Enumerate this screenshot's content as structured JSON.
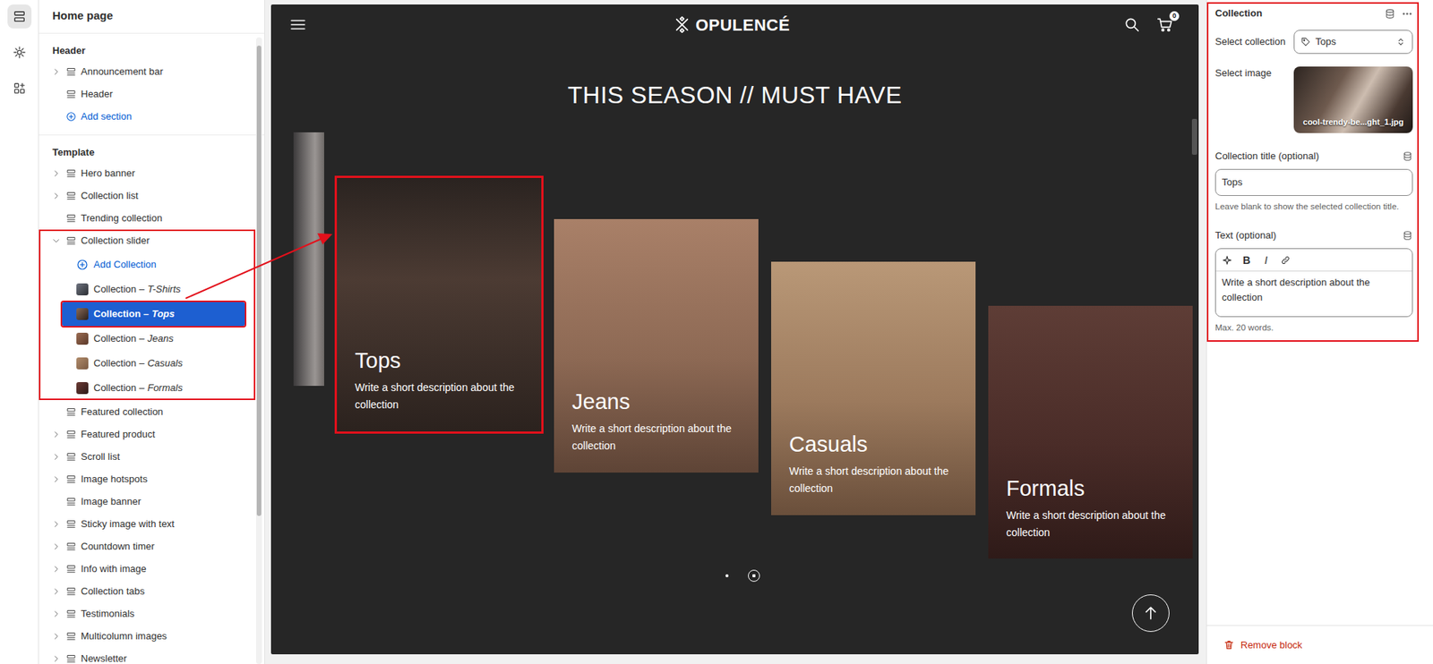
{
  "rail": [
    {
      "selected": true
    },
    {
      "selected": false
    },
    {
      "selected": false
    }
  ],
  "sidebar": {
    "title": "Home page",
    "groups": [
      {
        "label": "Header",
        "items": [
          {
            "kind": "section",
            "label": "Announcement bar",
            "expandable": true,
            "expanded": false,
            "annotated": false
          },
          {
            "kind": "section",
            "label": "Header",
            "expandable": false,
            "expanded": false,
            "annotated": false
          },
          {
            "kind": "add",
            "label": "Add section"
          }
        ]
      },
      {
        "label": "Template",
        "items": [
          {
            "kind": "section",
            "label": "Hero banner",
            "expandable": true,
            "expanded": false,
            "annotated": false
          },
          {
            "kind": "section",
            "label": "Collection list",
            "expandable": true,
            "expanded": false,
            "annotated": false
          },
          {
            "kind": "section",
            "label": "Trending collection",
            "expandable": false,
            "expanded": false,
            "annotated": false
          },
          {
            "kind": "section",
            "label": "Collection slider",
            "expandable": true,
            "expanded": true,
            "annotated": true,
            "children": [
              {
                "kind": "add",
                "label": "Add Collection"
              },
              {
                "kind": "block",
                "label": "Collection –",
                "detail": "T-Shirts",
                "selected": false,
                "annotated": false
              },
              {
                "kind": "block",
                "label": "Collection –",
                "detail": "Tops",
                "selected": true,
                "annotated": true
              },
              {
                "kind": "block",
                "label": "Collection –",
                "detail": "Jeans",
                "selected": false,
                "annotated": false
              },
              {
                "kind": "block",
                "label": "Collection –",
                "detail": "Casuals",
                "selected": false,
                "annotated": false
              },
              {
                "kind": "block",
                "label": "Collection –",
                "detail": "Formals",
                "selected": false,
                "annotated": false
              }
            ]
          },
          {
            "kind": "section",
            "label": "Featured collection",
            "expandable": false,
            "expanded": false,
            "annotated": false
          },
          {
            "kind": "section",
            "label": "Featured product",
            "expandable": true,
            "expanded": false,
            "annotated": false
          },
          {
            "kind": "section",
            "label": "Scroll list",
            "expandable": true,
            "expanded": false,
            "annotated": false
          },
          {
            "kind": "section",
            "label": "Image hotspots",
            "expandable": true,
            "expanded": false,
            "annotated": false
          },
          {
            "kind": "section",
            "label": "Image banner",
            "expandable": false,
            "expanded": false,
            "annotated": false
          },
          {
            "kind": "section",
            "label": "Sticky image with text",
            "expandable": true,
            "expanded": false,
            "annotated": false
          },
          {
            "kind": "section",
            "label": "Countdown timer",
            "expandable": true,
            "expanded": false,
            "annotated": false
          },
          {
            "kind": "section",
            "label": "Info with image",
            "expandable": true,
            "expanded": false,
            "annotated": false
          },
          {
            "kind": "section",
            "label": "Collection tabs",
            "expandable": true,
            "expanded": false,
            "annotated": false
          },
          {
            "kind": "section",
            "label": "Testimonials",
            "expandable": true,
            "expanded": false,
            "annotated": false
          },
          {
            "kind": "section",
            "label": "Multicolumn images",
            "expandable": true,
            "expanded": false,
            "annotated": false
          },
          {
            "kind": "section",
            "label": "Newsletter",
            "expandable": true,
            "expanded": false,
            "annotated": false
          }
        ]
      }
    ]
  },
  "preview": {
    "logo": "OPULENCÉ",
    "cart_count": "0",
    "heading": "THIS SEASON // MUST HAVE",
    "cards": [
      {
        "title": "Tops",
        "text": "Write a short description about the collection",
        "annotated": true
      },
      {
        "title": "Jeans",
        "text": "Write a short description about the collection",
        "annotated": false
      },
      {
        "title": "Casuals",
        "text": "Write a short description about the collection",
        "annotated": false
      },
      {
        "title": "Formals",
        "text": "Write a short description about the collection",
        "annotated": false
      }
    ],
    "dots": [
      {
        "selected": false
      },
      {
        "selected": true
      }
    ]
  },
  "inspector": {
    "title": "Collection",
    "annotated": true,
    "fields": [
      {
        "kind": "select",
        "label": "Select collection",
        "value": "Tops"
      },
      {
        "kind": "image",
        "label": "Select image",
        "filename": "cool-trendy-be...ght_1.jpg"
      },
      {
        "kind": "text",
        "label": "Collection title (optional)",
        "value": "Tops",
        "help": "Leave blank to show the selected collection title.",
        "dynamic_source": true
      },
      {
        "kind": "richtext",
        "label": "Text (optional)",
        "toolbar": [
          {
            "label": "B"
          },
          {
            "label": "I"
          }
        ],
        "value": "Write a short description about the collection",
        "help": "Max. 20 words.",
        "dynamic_source": true
      }
    ],
    "remove": "Remove block"
  }
}
